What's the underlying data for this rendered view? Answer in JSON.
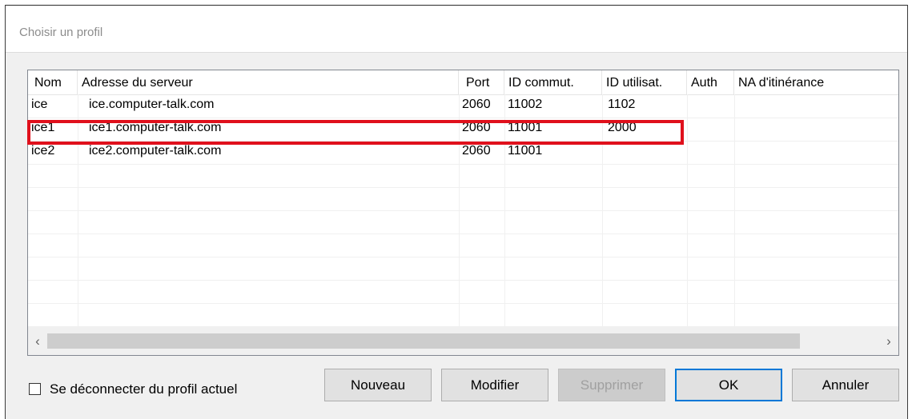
{
  "dialog": {
    "title": "Choisir un profil"
  },
  "list": {
    "columns": [
      {
        "key": "nom",
        "label": "Nom"
      },
      {
        "key": "adresse",
        "label": "Adresse du serveur"
      },
      {
        "key": "port",
        "label": "Port"
      },
      {
        "key": "id_commut",
        "label": "ID commut."
      },
      {
        "key": "id_util",
        "label": "ID utilisat."
      },
      {
        "key": "auth",
        "label": "Auth"
      },
      {
        "key": "na",
        "label": "NA d'itinérance"
      }
    ],
    "rows": [
      {
        "nom": "ice",
        "adresse": "ice.computer-talk.com",
        "port": "2060",
        "id_commut": "11002",
        "id_util": "1102",
        "auth": "",
        "na": ""
      },
      {
        "nom": "ice1",
        "adresse": "ice1.computer-talk.com",
        "port": "2060",
        "id_commut": "11001",
        "id_util": "2000",
        "auth": "",
        "na": ""
      },
      {
        "nom": "ice2",
        "adresse": "ice2.computer-talk.com",
        "port": "2060",
        "id_commut": "11001",
        "id_util": "",
        "auth": "",
        "na": ""
      }
    ],
    "highlighted_row": 1,
    "highlight_color": "#e0101c",
    "scroll_left_icon": "chevron-left-icon",
    "scroll_right_icon": "chevron-right-icon"
  },
  "options": {
    "disconnect_label": "Se déconnecter du profil actuel",
    "disconnect_checked": false
  },
  "buttons": {
    "new": "Nouveau",
    "edit": "Modifier",
    "delete": "Supprimer",
    "ok": "OK",
    "cancel": "Annuler"
  }
}
